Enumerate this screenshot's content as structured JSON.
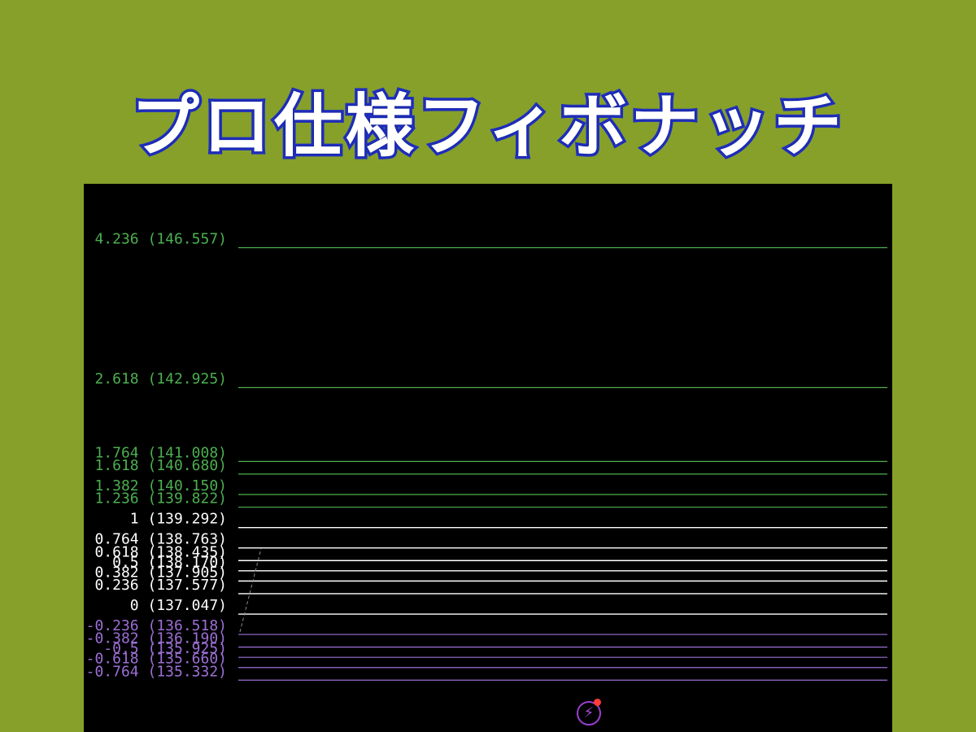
{
  "title": "プロ仕様フィボナッチ",
  "icons": {
    "alert": "lightning-alert-icon",
    "alert_badge": "red-notification-dot"
  },
  "colors": {
    "background": "#86a02a",
    "title_fill": "#ffffff",
    "title_outline": "#1f2fbf",
    "chart_background": "#000000",
    "upper_extension": "#4caf50",
    "retracement": "#ffffff",
    "lower_extension": "#9c6fd6"
  },
  "chart_data": {
    "type": "fibonacci",
    "ylim": [
      135.0,
      147.2
    ],
    "levels": [
      {
        "ratio": 4.236,
        "price": 146.557,
        "label": "4.236 (146.557)",
        "group": "upper"
      },
      {
        "ratio": 2.618,
        "price": 142.925,
        "label": "2.618 (142.925)",
        "group": "upper"
      },
      {
        "ratio": 1.764,
        "price": 141.008,
        "label": "1.764 (141.008)",
        "group": "upper"
      },
      {
        "ratio": 1.618,
        "price": 140.68,
        "label": "1.618 (140.680)",
        "group": "upper"
      },
      {
        "ratio": 1.382,
        "price": 140.15,
        "label": "1.382 (140.150)",
        "group": "upper"
      },
      {
        "ratio": 1.236,
        "price": 139.822,
        "label": "1.236 (139.822)",
        "group": "upper"
      },
      {
        "ratio": 1,
        "price": 139.292,
        "label": "1 (139.292)",
        "group": "core"
      },
      {
        "ratio": 0.764,
        "price": 138.763,
        "label": "0.764 (138.763)",
        "group": "core"
      },
      {
        "ratio": 0.618,
        "price": 138.435,
        "label": "0.618 (138.435)",
        "group": "core"
      },
      {
        "ratio": 0.5,
        "price": 138.17,
        "label": "0.5 (138.170)",
        "group": "core"
      },
      {
        "ratio": 0.382,
        "price": 137.905,
        "label": "0.382 (137.905)",
        "group": "core"
      },
      {
        "ratio": 0.236,
        "price": 137.577,
        "label": "0.236 (137.577)",
        "group": "core"
      },
      {
        "ratio": 0,
        "price": 137.047,
        "label": "0 (137.047)",
        "group": "core"
      },
      {
        "ratio": -0.236,
        "price": 136.518,
        "label": "-0.236 (136.518)",
        "group": "lower"
      },
      {
        "ratio": -0.382,
        "price": 136.19,
        "label": "-0.382 (136.190)",
        "group": "lower"
      },
      {
        "ratio": -0.5,
        "price": 135.925,
        "label": "-0.5 (135.925)",
        "group": "lower"
      },
      {
        "ratio": -0.618,
        "price": 135.66,
        "label": "-0.618 (135.660)",
        "group": "lower"
      },
      {
        "ratio": -0.764,
        "price": 135.332,
        "label": "-0.764 (135.332)",
        "group": "lower"
      }
    ],
    "trend_line": {
      "from_ratio": 0,
      "to_ratio": 1,
      "style": "dashed"
    }
  }
}
